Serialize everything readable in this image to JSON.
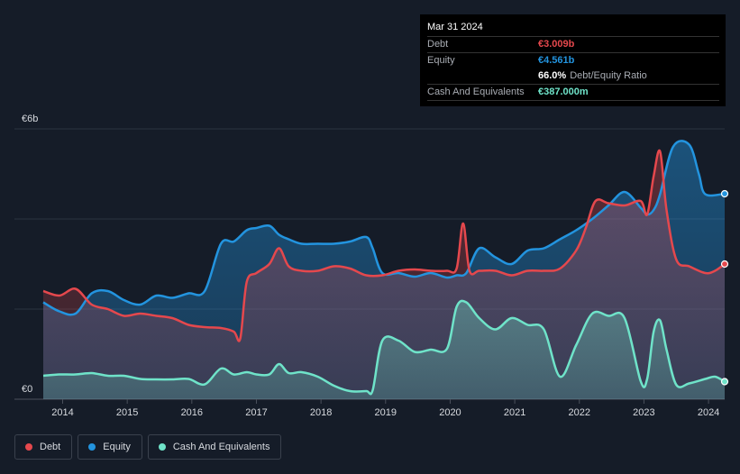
{
  "tooltip": {
    "date": "Mar 31 2024",
    "debt_label": "Debt",
    "debt_value": "€3.009b",
    "equity_label": "Equity",
    "equity_value": "€4.561b",
    "ratio_value": "66.0%",
    "ratio_label": "Debt/Equity Ratio",
    "cash_label": "Cash And Equivalents",
    "cash_value": "€387.000m"
  },
  "legend": {
    "debt": "Debt",
    "equity": "Equity",
    "cash": "Cash And Equivalents"
  },
  "colors": {
    "background": "#151c28",
    "debt": "#e5484d",
    "equity": "#2394df",
    "cash": "#6fe3c9"
  },
  "chart_data": {
    "type": "area",
    "x_ticks": [
      "2014",
      "2015",
      "2016",
      "2017",
      "2018",
      "2019",
      "2020",
      "2021",
      "2022",
      "2023",
      "2024"
    ],
    "y_ticks": [
      "€0",
      "€6b"
    ],
    "ylim": [
      0,
      6
    ],
    "xlim": [
      2013.7,
      2024.25
    ],
    "grid": true,
    "legend_position": "bottom-left",
    "series": [
      {
        "name": "Debt",
        "color": "#e5484d",
        "x": [
          2013.7,
          2013.95,
          2014.2,
          2014.45,
          2014.7,
          2014.95,
          2015.2,
          2015.45,
          2015.7,
          2015.95,
          2016.2,
          2016.45,
          2016.65,
          2016.75,
          2016.85,
          2017.0,
          2017.2,
          2017.35,
          2017.5,
          2017.7,
          2017.95,
          2018.2,
          2018.45,
          2018.7,
          2018.95,
          2019.2,
          2019.45,
          2019.7,
          2019.95,
          2020.1,
          2020.2,
          2020.3,
          2020.45,
          2020.7,
          2020.95,
          2021.2,
          2021.45,
          2021.7,
          2021.95,
          2022.1,
          2022.25,
          2022.45,
          2022.7,
          2022.95,
          2023.05,
          2023.15,
          2023.25,
          2023.35,
          2023.5,
          2023.7,
          2023.95,
          2024.1,
          2024.25
        ],
        "values": [
          2.4,
          2.3,
          2.45,
          2.1,
          2.0,
          1.85,
          1.9,
          1.85,
          1.8,
          1.65,
          1.6,
          1.58,
          1.5,
          1.35,
          2.6,
          2.8,
          3.0,
          3.35,
          2.95,
          2.85,
          2.85,
          2.95,
          2.9,
          2.75,
          2.75,
          2.85,
          2.88,
          2.85,
          2.85,
          2.9,
          3.9,
          2.85,
          2.85,
          2.85,
          2.75,
          2.85,
          2.85,
          2.9,
          3.3,
          3.8,
          4.4,
          4.35,
          4.3,
          4.4,
          4.1,
          4.95,
          5.5,
          4.2,
          3.1,
          2.95,
          2.8,
          2.85,
          3.0
        ]
      },
      {
        "name": "Equity",
        "color": "#2394df",
        "x": [
          2013.7,
          2013.95,
          2014.2,
          2014.45,
          2014.7,
          2014.95,
          2015.2,
          2015.45,
          2015.7,
          2015.95,
          2016.2,
          2016.45,
          2016.65,
          2016.85,
          2017.0,
          2017.2,
          2017.35,
          2017.5,
          2017.7,
          2017.95,
          2018.2,
          2018.45,
          2018.7,
          2018.8,
          2018.95,
          2019.2,
          2019.45,
          2019.7,
          2019.95,
          2020.1,
          2020.25,
          2020.45,
          2020.7,
          2020.95,
          2021.2,
          2021.45,
          2021.7,
          2021.95,
          2022.2,
          2022.45,
          2022.7,
          2022.95,
          2023.05,
          2023.15,
          2023.25,
          2023.45,
          2023.7,
          2023.85,
          2023.95,
          2024.25
        ],
        "values": [
          2.15,
          1.95,
          1.9,
          2.35,
          2.4,
          2.2,
          2.1,
          2.3,
          2.25,
          2.35,
          2.4,
          3.45,
          3.5,
          3.75,
          3.8,
          3.85,
          3.65,
          3.55,
          3.45,
          3.45,
          3.45,
          3.5,
          3.6,
          3.35,
          2.8,
          2.8,
          2.72,
          2.8,
          2.7,
          2.75,
          2.8,
          3.35,
          3.15,
          3.0,
          3.3,
          3.35,
          3.55,
          3.75,
          4.0,
          4.3,
          4.6,
          4.25,
          4.1,
          4.2,
          4.55,
          5.6,
          5.65,
          5.0,
          4.55,
          4.56
        ]
      },
      {
        "name": "Cash And Equivalents",
        "color": "#6fe3c9",
        "x": [
          2013.7,
          2013.95,
          2014.2,
          2014.45,
          2014.7,
          2014.95,
          2015.2,
          2015.45,
          2015.7,
          2015.95,
          2016.2,
          2016.45,
          2016.65,
          2016.85,
          2017.0,
          2017.2,
          2017.35,
          2017.5,
          2017.7,
          2017.95,
          2018.2,
          2018.45,
          2018.7,
          2018.8,
          2018.95,
          2019.2,
          2019.45,
          2019.7,
          2019.95,
          2020.1,
          2020.25,
          2020.45,
          2020.7,
          2020.95,
          2021.2,
          2021.45,
          2021.7,
          2021.95,
          2022.2,
          2022.45,
          2022.7,
          2022.95,
          2023.05,
          2023.15,
          2023.25,
          2023.35,
          2023.5,
          2023.7,
          2023.95,
          2024.1,
          2024.25
        ],
        "values": [
          0.52,
          0.55,
          0.55,
          0.58,
          0.52,
          0.52,
          0.45,
          0.44,
          0.44,
          0.45,
          0.33,
          0.68,
          0.55,
          0.6,
          0.55,
          0.55,
          0.78,
          0.58,
          0.6,
          0.5,
          0.3,
          0.18,
          0.18,
          0.2,
          1.3,
          1.3,
          1.05,
          1.1,
          1.12,
          2.05,
          2.15,
          1.8,
          1.55,
          1.8,
          1.65,
          1.55,
          0.5,
          1.2,
          1.9,
          1.85,
          1.8,
          0.4,
          0.45,
          1.5,
          1.75,
          1.1,
          0.32,
          0.35,
          0.45,
          0.5,
          0.39
        ]
      }
    ]
  }
}
